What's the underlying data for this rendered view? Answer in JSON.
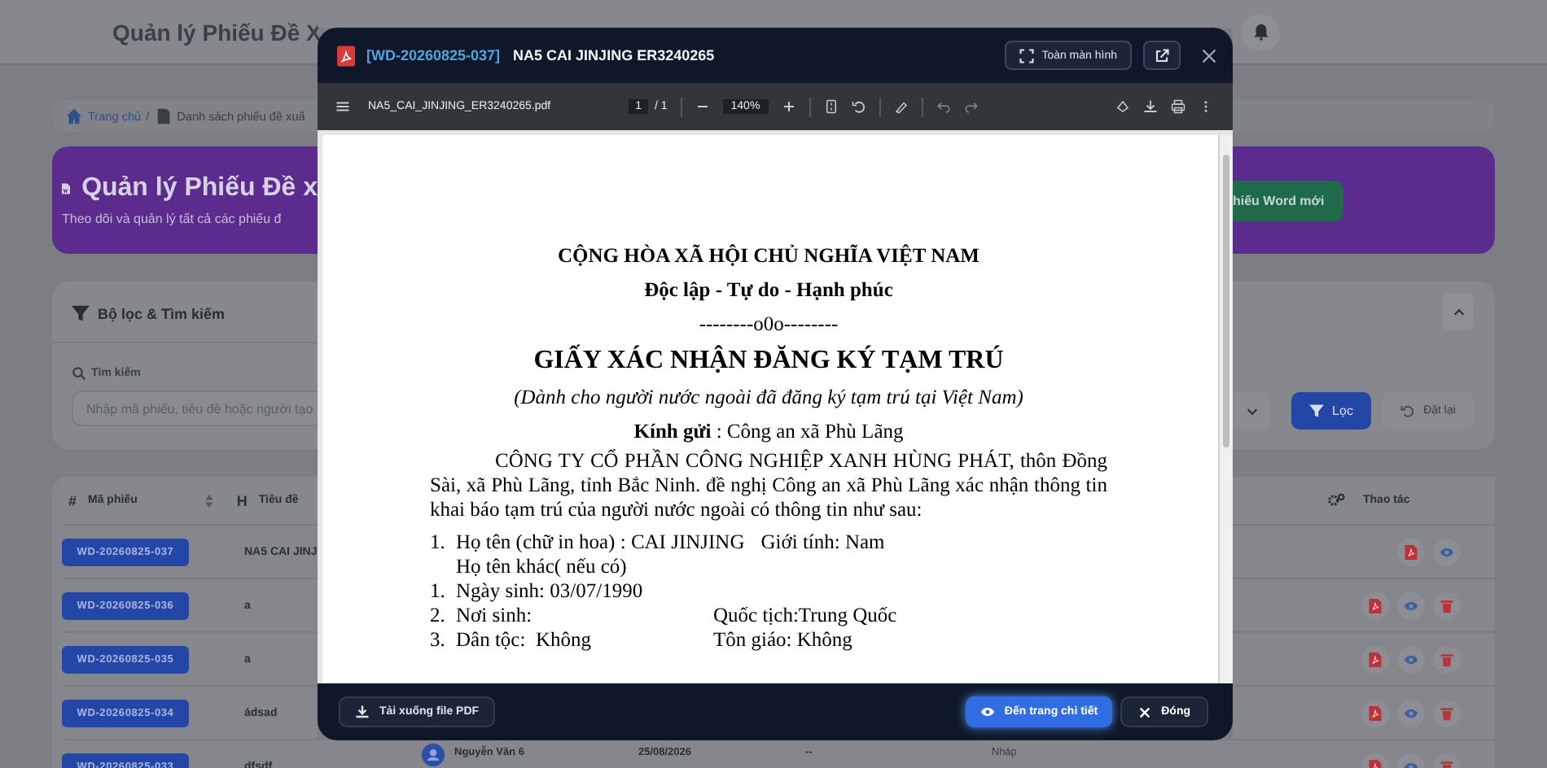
{
  "app_header": {
    "title": "Quản lý Phiếu Đề X"
  },
  "breadcrumb": [
    "Trang chủ",
    "/",
    "Danh sách phiếu đề xuấ"
  ],
  "banner": {
    "title": "Quản lý Phiếu Đề x",
    "subtitle": "Theo dõi và quản lý tất cả các phiếu đ",
    "button": "hiếu Word mới"
  },
  "filter": {
    "title": "Bộ lọc & Tìm kiếm",
    "search_label": "Tìm kiếm",
    "search_placeholder": "Nhập mã phiếu, tiêu đề hoặc người tạo",
    "buttons": [
      {
        "kind": "apply",
        "label": "Lọc"
      },
      {
        "kind": "reset",
        "label": "Đặt lại"
      }
    ]
  },
  "table": {
    "columns": [
      {
        "icon": "#",
        "label": "Mã phiếu"
      },
      {
        "icon": "H",
        "label": "Tiêu đề"
      },
      {
        "label": "Thao tác"
      }
    ],
    "rows": [
      {
        "code": "WD-20260825-037",
        "title": "NA5 CAI JINJ",
        "deletable": false
      },
      {
        "code": "WD-20260825-036",
        "title": "a",
        "deletable": true
      },
      {
        "code": "WD-20260825-035",
        "title": "a",
        "deletable": true
      },
      {
        "code": "WD-20260825-034",
        "title": "ádsad",
        "deletable": true
      },
      {
        "code": "WD-20260825-033",
        "title": "dfsdf",
        "deletable": true,
        "creator": "Nguyễn Văn 6",
        "date": "25/08/2026",
        "column_6": "--",
        "status": "Nháp"
      }
    ]
  },
  "viewer": {
    "code": "[WD-20260825-037]",
    "title": "NA5 CAI JINJING ER3240265",
    "fullscreen_button": "Toàn màn hình",
    "file_name": "NA5_CAI_JINJING_ER3240265.pdf",
    "page": "1",
    "page_count": "/ 1",
    "zoom": "140%",
    "document": [
      {
        "kind": "heading",
        "text": "CỘNG HÒA XÃ HỘI CHỦ NGHĨA VIỆT NAM"
      },
      {
        "kind": "heading",
        "text": "Độc lập - Tự do - Hạnh phúc"
      },
      {
        "kind": "center",
        "text": "--------o0o--------"
      },
      {
        "kind": "title",
        "text": "GIẤY XÁC NHẬN ĐĂNG KÝ TẠM TRÚ"
      },
      {
        "kind": "italic",
        "text": "(Dành cho người nước ngoài đã đăng ký tạm trú tại Việt Nam)"
      },
      {
        "kind": "address",
        "text": "**Kính gửi** : Công an xã Phù Lãng"
      },
      {
        "kind": "paragraph",
        "text": "CÔNG TY CỔ PHẦN CÔNG NGHIỆP XANH HÙNG PHÁT, thôn Đồng Sài, xã Phù Lãng, tỉnh Bắc Ninh. đề nghị Công an xã Phù Lãng xác nhận thông tin khai báo tạm trú của người nước ngoài có thông tin như sau:"
      },
      {
        "kind": "item",
        "num": "1.",
        "text": "Họ tên (chữ in hoa) : CAI JINJING",
        "extra": "Giới tính: Nam",
        "continuation": "Họ tên khác( nếu có)"
      },
      {
        "kind": "item",
        "num": "1.",
        "text": "Ngày sinh: 03/07/1990"
      },
      {
        "kind": "item",
        "num": "2.",
        "text": "Nơi sinh:",
        "extra": "Quốc tịch:Trung Quốc"
      },
      {
        "kind": "item",
        "num": "3.",
        "text": "Dân tộc:  Không",
        "extra": "Tôn giáo: Không"
      }
    ],
    "footer": {
      "download": "Tải xuống file PDF",
      "detail": "Đến trang chi tiết",
      "close": "Đóng"
    }
  }
}
